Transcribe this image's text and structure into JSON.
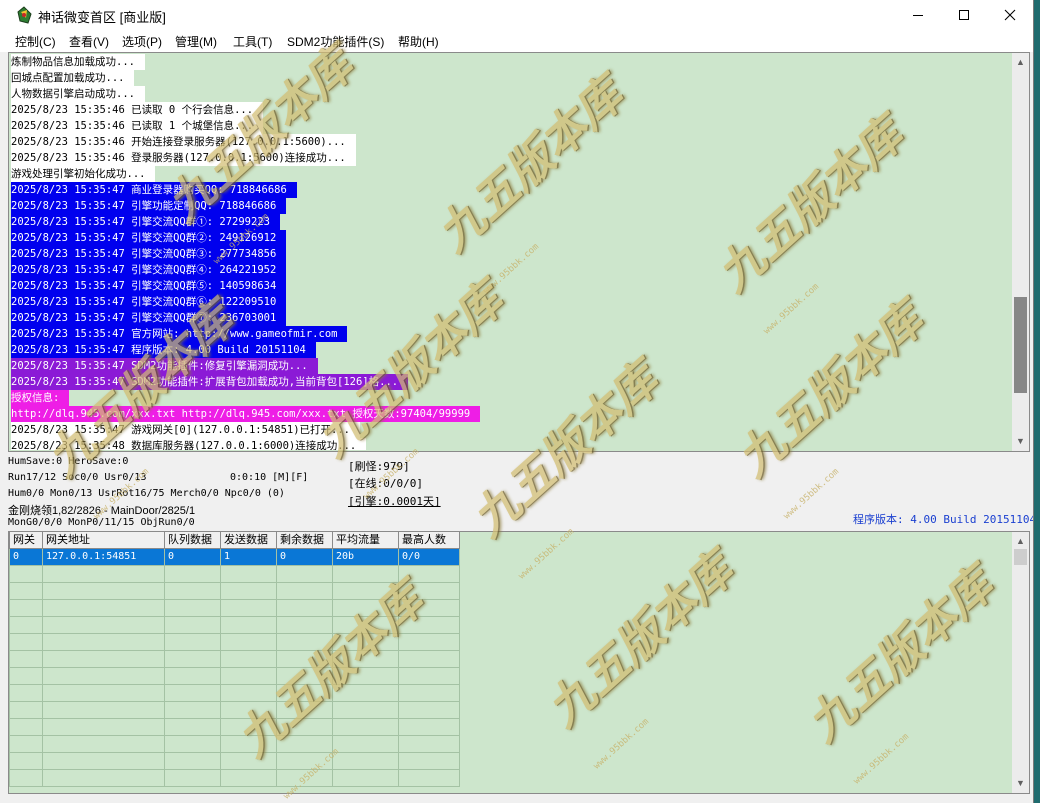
{
  "window": {
    "title": "神话微变首区 [商业版]",
    "minimize_glyph": "—",
    "maximize_glyph": "☐",
    "close_glyph": "✕"
  },
  "menu": [
    "控制(C)",
    "查看(V)",
    "选项(P)",
    "管理(M)",
    "工具(T)",
    "SDM2功能插件(S)",
    "帮助(H)"
  ],
  "log": {
    "lines": [
      {
        "text": "炼制物品信息加载成功...",
        "bg": "#ffffff",
        "fg": "#000000"
      },
      {
        "text": "回城点配置加载成功...",
        "bg": "#ffffff",
        "fg": "#000000"
      },
      {
        "text": "人物数据引擎启动成功...",
        "bg": "#ffffff",
        "fg": "#000000"
      },
      {
        "text": "2025/8/23 15:35:46 已读取 0 个行会信息...",
        "bg": "#ffffff",
        "fg": "#000000"
      },
      {
        "text": "2025/8/23 15:35:46 已读取 1 个城堡信息...",
        "bg": "#ffffff",
        "fg": "#000000"
      },
      {
        "text": "2025/8/23 15:35:46 开始连接登录服务器(127.0.0.1:5600)...",
        "bg": "#ffffff",
        "fg": "#000000"
      },
      {
        "text": "2025/8/23 15:35:46 登录服务器(127.0.0.1:5600)连接成功...",
        "bg": "#ffffff",
        "fg": "#000000"
      },
      {
        "text": "游戏处理引擎初始化成功...",
        "bg": "#ffffff",
        "fg": "#000000"
      },
      {
        "text": "2025/8/23 15:35:47 商业登录器购买QQ: 718846686",
        "bg": "#0000ee",
        "fg": "#ffffff"
      },
      {
        "text": "2025/8/23 15:35:47 引擎功能定制QQ: 718846686",
        "bg": "#0000ee",
        "fg": "#ffffff"
      },
      {
        "text": "2025/8/23 15:35:47 引擎交流QQ群①: 27299223",
        "bg": "#0000ee",
        "fg": "#ffffff"
      },
      {
        "text": "2025/8/23 15:35:47 引擎交流QQ群②: 249126912",
        "bg": "#0000ee",
        "fg": "#ffffff"
      },
      {
        "text": "2025/8/23 15:35:47 引擎交流QQ群③: 277734856",
        "bg": "#0000ee",
        "fg": "#ffffff"
      },
      {
        "text": "2025/8/23 15:35:47 引擎交流QQ群④: 264221952",
        "bg": "#0000ee",
        "fg": "#ffffff"
      },
      {
        "text": "2025/8/23 15:35:47 引擎交流QQ群⑤: 140598634",
        "bg": "#0000ee",
        "fg": "#ffffff"
      },
      {
        "text": "2025/8/23 15:35:47 引擎交流QQ群⑥: 122209510",
        "bg": "#0000ee",
        "fg": "#ffffff"
      },
      {
        "text": "2025/8/23 15:35:47 引擎交流QQ群⑦: 236703001",
        "bg": "#0000ee",
        "fg": "#ffffff"
      },
      {
        "text": "2025/8/23 15:35:47 官方网站: http://www.gameofmir.com",
        "bg": "#0000ee",
        "fg": "#ffffff"
      },
      {
        "text": "2025/8/23 15:35:47 程序版本: 4.00 Build 20151104",
        "bg": "#0000ee",
        "fg": "#ffffff"
      },
      {
        "text": "2025/8/23 15:35:47 SDM2功能插件:修复引擎漏洞成功...",
        "bg": "#8b1ad6",
        "fg": "#ffffff"
      },
      {
        "text": "2025/8/23 15:35:47 SDM2功能插件:扩展背包加载成功,当前背包[126]格...",
        "bg": "#8b1ad6",
        "fg": "#ffffff"
      },
      {
        "text": "授权信息:",
        "bg": "#ee1ee6",
        "fg": "#ffffff"
      },
      {
        "text": "http://dlq.945.com/xxx.txt http://dlq.945.com/xxx.txt 授权天数:97404/99999",
        "bg": "#ee1ee6",
        "fg": "#ffffff"
      },
      {
        "text": "2025/8/23 15:35:47 游戏网关[0](127.0.0.1:54851)已打开...",
        "bg": "#ffffff",
        "fg": "#000000"
      },
      {
        "text": "2025/8/23 15:35:48 数据库服务器(127.0.0.1:6000)连接成功...",
        "bg": "#ffffff",
        "fg": "#000000"
      }
    ]
  },
  "status": {
    "line1": "HumSave:0 HeroSave:0",
    "line2": "Run17/12 Soc0/0 Usr0/13",
    "timer": "0:0:10 [M][F]",
    "line3": "Hum0/0 Mon0/13 UsrRot16/75 Merch0/0 Npc0/0 (0)",
    "line4": "金刚烧领1,82/2826 - MainDoor/2825/1",
    "line5": "MonG0/0/0 MonP0/11/15 ObjRun0/0",
    "refresh": "[刷怪:979]",
    "online": "[在线:0/0/0]",
    "engine": "[引擎:0.0001天]",
    "version": "程序版本: 4.00 Build 20151104",
    "version_color": "#1a3fd0"
  },
  "grid": {
    "headers": [
      "网关",
      "网关地址",
      "队列数据",
      "发送数据",
      "剩余数据",
      "平均流量",
      "最高人数"
    ],
    "rows": [
      [
        "0",
        "127.0.0.1:54851",
        "0",
        "1",
        "0",
        "20b",
        "0/0"
      ]
    ]
  },
  "watermark": {
    "text": "九五版本库",
    "url": "www.95bbk.com"
  }
}
